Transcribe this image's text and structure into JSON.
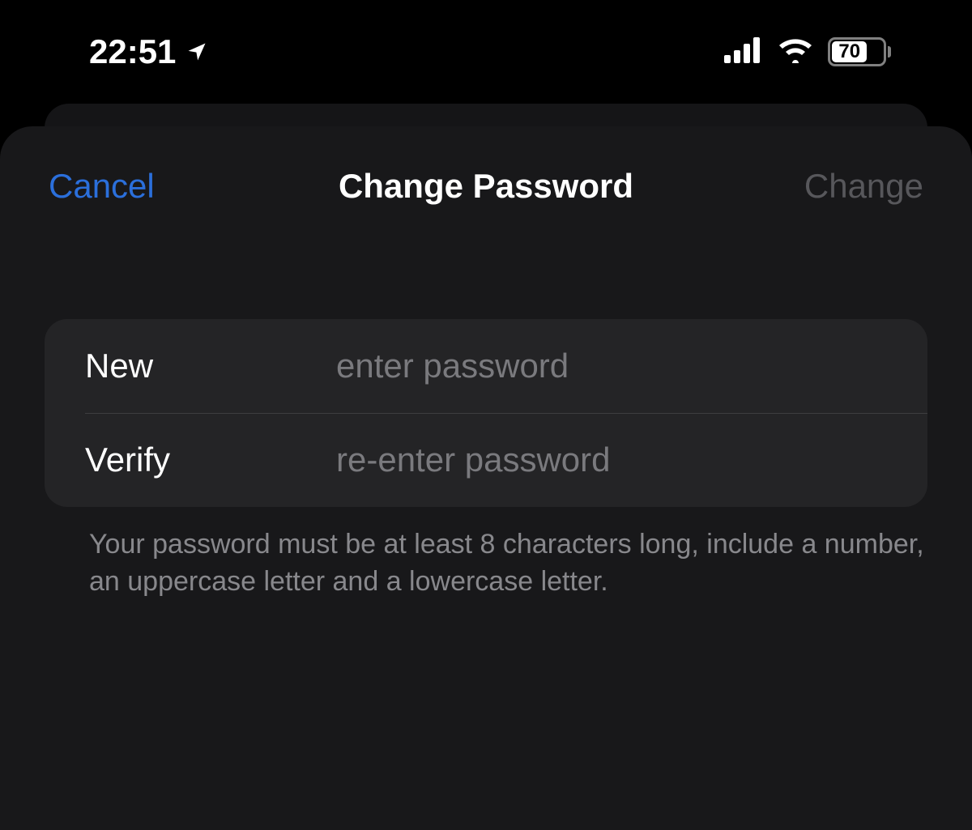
{
  "status_bar": {
    "time": "22:51",
    "battery_percent": "70",
    "battery_fill_width": "70%"
  },
  "modal": {
    "cancel_label": "Cancel",
    "title": "Change Password",
    "confirm_label": "Change",
    "fields": {
      "new": {
        "label": "New",
        "placeholder": "enter password",
        "value": ""
      },
      "verify": {
        "label": "Verify",
        "placeholder": "re-enter password",
        "value": ""
      }
    },
    "help_text": "Your password must be at least 8 characters long, include a number, an uppercase letter and a lowercase letter."
  }
}
